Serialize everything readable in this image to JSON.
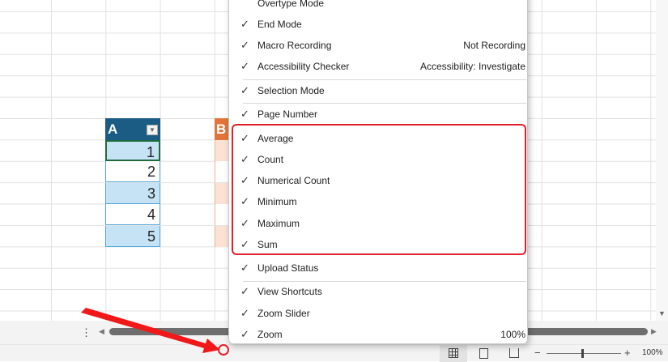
{
  "table_a": {
    "header": "A",
    "values": [
      "1",
      "2",
      "3",
      "4",
      "5"
    ]
  },
  "table_b": {
    "header": "B"
  },
  "menu": {
    "items": [
      {
        "label": "Overtype Mode",
        "checked": false,
        "value": ""
      },
      {
        "label": "End Mode",
        "checked": true,
        "value": ""
      },
      {
        "label": "Macro Recording",
        "checked": true,
        "value": "Not Recording"
      },
      {
        "label": "Accessibility Checker",
        "checked": true,
        "value": "Accessibility: Investigate"
      },
      {
        "label": "Selection Mode",
        "checked": true,
        "value": ""
      },
      {
        "label": "Page Number",
        "checked": true,
        "value": ""
      },
      {
        "label": "Average",
        "checked": true,
        "value": ""
      },
      {
        "label": "Count",
        "checked": true,
        "value": ""
      },
      {
        "label": "Numerical Count",
        "checked": true,
        "value": ""
      },
      {
        "label": "Minimum",
        "checked": true,
        "value": ""
      },
      {
        "label": "Maximum",
        "checked": true,
        "value": ""
      },
      {
        "label": "Sum",
        "checked": true,
        "value": ""
      },
      {
        "label": "Upload Status",
        "checked": true,
        "value": ""
      },
      {
        "label": "View Shortcuts",
        "checked": true,
        "value": ""
      },
      {
        "label": "Zoom Slider",
        "checked": true,
        "value": ""
      },
      {
        "label": "Zoom",
        "checked": true,
        "value": "100%"
      }
    ],
    "check_glyph": "✓"
  },
  "status": {
    "zoom": "100%",
    "minus": "−",
    "plus": "+",
    "more": "⋮"
  },
  "colors": {
    "highlight": "#e0202a",
    "table_a_header": "#1a5c84",
    "table_b_header": "#e2763a"
  }
}
